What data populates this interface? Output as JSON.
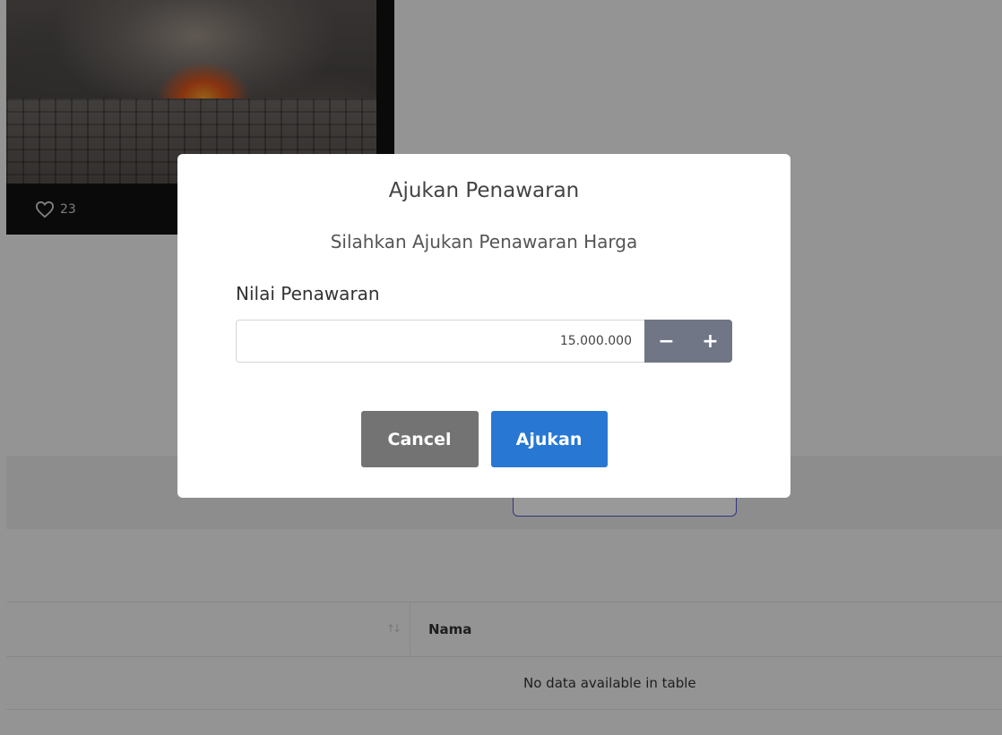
{
  "card": {
    "like_count": "23"
  },
  "table": {
    "columns": [
      "",
      "Nama"
    ],
    "empty_message": "No data available in table"
  },
  "modal": {
    "title": "Ajukan Penawaran",
    "subtitle": "Silahkan Ajukan Penawaran Harga",
    "field_label": "Nilai Penawaran",
    "amount_value": "15.000.000",
    "decrement_label": "−",
    "increment_label": "+",
    "cancel_label": "Cancel",
    "submit_label": "Ajukan"
  },
  "colors": {
    "submit": "#2878d3",
    "cancel": "#737373",
    "stepper": "#707685",
    "outline_button": "#5458d8"
  },
  "icons": {
    "like": "heart-icon",
    "sort": "sort-icon"
  }
}
